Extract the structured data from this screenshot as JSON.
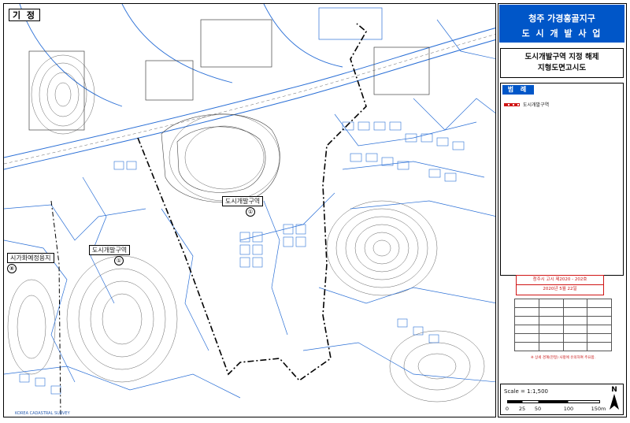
{
  "map": {
    "corner_label": "기 정",
    "labels": {
      "center": "도시개발구역",
      "center_num": "①",
      "west": "도시개발구역",
      "west_num": "①",
      "far_west": "시가화예정용지",
      "far_west_num": "⑧"
    },
    "footer_mark": "KOREA CADASTRAL SURVEY"
  },
  "panel": {
    "title_line1": "청주 가경홍골지구",
    "title_line2": "도 시 개 발 사 업",
    "subtitle_line1": "도시개발구역 지정 해제",
    "subtitle_line2": "지형도면고시도",
    "legend_head": "범 례",
    "legend_item": "도시개발구역",
    "stamp_line1": "청주시 고시 제2020 - 202호",
    "stamp_line2": "2020년 5월 22일",
    "notice": "※ 상세 경계(한정) 사항에 유의하여 주요합."
  },
  "scale": {
    "label": "Scale = 1:1,500",
    "ticks": [
      "0",
      "25",
      "50",
      "100",
      "150m"
    ],
    "north": "N"
  },
  "colors": {
    "title_bg": "#0056c8",
    "map_lines": "#2a6fd6",
    "boundary": "#000000",
    "legend_red": "#d01515"
  }
}
